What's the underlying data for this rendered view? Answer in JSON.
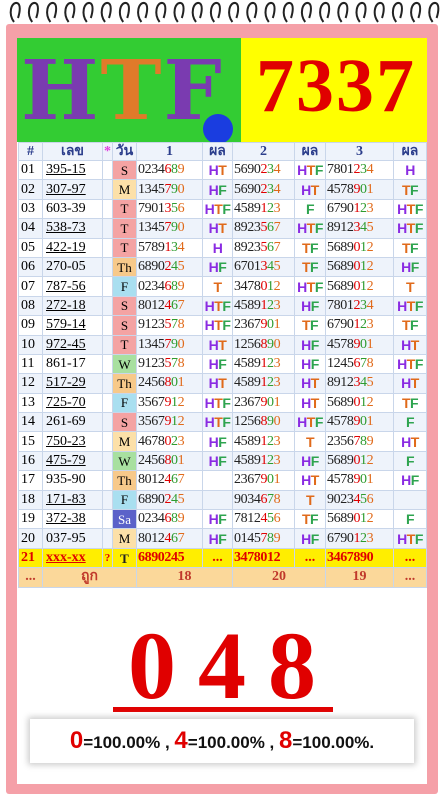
{
  "banner": {
    "brand": [
      "H",
      "T",
      "F",
      "."
    ],
    "number": "7337"
  },
  "table": {
    "headers": [
      "#",
      "เลข",
      "*",
      "วัน",
      "1",
      "ผล",
      "2",
      "ผล",
      "3",
      "ผล"
    ],
    "rows": [
      {
        "no": "01",
        "id": "395-15",
        "day": "S",
        "day_color": "#f4a3a3",
        "d1": "0234689",
        "r1": "HT",
        "d2": "5690234",
        "r2": "HTF",
        "d3": "7801234",
        "r3": "H",
        "u": true
      },
      {
        "no": "02",
        "id": "307-97",
        "day": "M",
        "day_color": "#fce0a8",
        "d1": "1345790",
        "r1": "HF",
        "d2": "5690234",
        "r2": "HT",
        "d3": "4578901",
        "r3": "TF",
        "u": true
      },
      {
        "no": "03",
        "id": "603-39",
        "day": "T",
        "day_color": "#f4a3a3",
        "d1": "7901356",
        "r1": "HTF",
        "d2": "4589123",
        "r2": "F",
        "d3": "6790123",
        "r3": "HTF",
        "u": false
      },
      {
        "no": "04",
        "id": "538-73",
        "day": "T",
        "day_color": "#f4a3a3",
        "d1": "1345790",
        "r1": "HT",
        "d2": "8923567",
        "r2": "HTF",
        "d3": "8912345",
        "r3": "HTF",
        "u": true
      },
      {
        "no": "05",
        "id": "422-19",
        "day": "T",
        "day_color": "#f4a3a3",
        "d1": "5789134",
        "r1": "H",
        "d2": "8923567",
        "r2": "TF",
        "d3": "5689012",
        "r3": "TF",
        "u": true
      },
      {
        "no": "06",
        "id": "270-05",
        "day": "Th",
        "day_color": "#f7c98a",
        "d1": "6890245",
        "r1": "HF",
        "d2": "6701345",
        "r2": "TF",
        "d3": "5689012",
        "r3": "HF",
        "u": false
      },
      {
        "no": "07",
        "id": "787-56",
        "day": "F",
        "day_color": "#a9dff0",
        "d1": "0234689",
        "r1": "T",
        "d2": "3478012",
        "r2": "HTF",
        "d3": "5689012",
        "r3": "T",
        "u": true
      },
      {
        "no": "08",
        "id": "272-18",
        "day": "S",
        "day_color": "#f4a3a3",
        "d1": "8012467",
        "r1": "HTF",
        "d2": "4589123",
        "r2": "HF",
        "d3": "7801234",
        "r3": "HTF",
        "u": true
      },
      {
        "no": "09",
        "id": "579-14",
        "day": "S",
        "day_color": "#f4a3a3",
        "d1": "9123578",
        "r1": "HTF",
        "d2": "2367901",
        "r2": "TF",
        "d3": "6790123",
        "r3": "TF",
        "u": true
      },
      {
        "no": "10",
        "id": "972-45",
        "day": "T",
        "day_color": "#f4a3a3",
        "d1": "1345790",
        "r1": "HT",
        "d2": "1256890",
        "r2": "HF",
        "d3": "4578901",
        "r3": "HT",
        "u": true
      },
      {
        "no": "11",
        "id": "861-17",
        "day": "W",
        "day_color": "#a8e0a0",
        "d1": "9123578",
        "r1": "HF",
        "d2": "4589123",
        "r2": "HF",
        "d3": "1245678",
        "r3": "HTF",
        "u": false
      },
      {
        "no": "12",
        "id": "517-29",
        "day": "Th",
        "day_color": "#f7c98a",
        "d1": "2456801",
        "r1": "HT",
        "d2": "4589123",
        "r2": "HT",
        "d3": "8912345",
        "r3": "HT",
        "u": true
      },
      {
        "no": "13",
        "id": "725-70",
        "day": "F",
        "day_color": "#a9dff0",
        "d1": "3567912",
        "r1": "HTF",
        "d2": "2367901",
        "r2": "HT",
        "d3": "5689012",
        "r3": "TF",
        "u": true
      },
      {
        "no": "14",
        "id": "261-69",
        "day": "S",
        "day_color": "#f4a3a3",
        "d1": "3567912",
        "r1": "HTF",
        "d2": "1256890",
        "r2": "HTF",
        "d3": "4578901",
        "r3": "F",
        "u": false
      },
      {
        "no": "15",
        "id": "750-23",
        "day": "M",
        "day_color": "#fce0a8",
        "d1": "4678023",
        "r1": "HF",
        "d2": "4589123",
        "r2": "T",
        "d3": "2356789",
        "r3": "HT",
        "u": true
      },
      {
        "no": "16",
        "id": "475-79",
        "day": "W",
        "day_color": "#a8e0a0",
        "d1": "2456801",
        "r1": "HF",
        "d2": "4589123",
        "r2": "HF",
        "d3": "5689012",
        "r3": "F",
        "u": true
      },
      {
        "no": "17",
        "id": "935-90",
        "day": "Th",
        "day_color": "#f7c98a",
        "d1": "8012467",
        "r1": "",
        "d2": "2367901",
        "r2": "HT",
        "d3": "4578901",
        "r3": "HF",
        "u": false
      },
      {
        "no": "18",
        "id": "171-83",
        "day": "F",
        "day_color": "#a9dff0",
        "d1": "6890245",
        "r1": "",
        "d2": "9034678",
        "r2": "T",
        "d3": "9023456",
        "r3": "",
        "u": true
      },
      {
        "no": "19",
        "id": "372-38",
        "day": "Sa",
        "day_color": "#5b62c9",
        "d1": "0234689",
        "r1": "HF",
        "d2": "7812456",
        "r2": "TF",
        "d3": "5689012",
        "r3": "F",
        "u": true
      },
      {
        "no": "20",
        "id": "037-95",
        "day": "M",
        "day_color": "#fce0a8",
        "d1": "8012467",
        "r1": "HF",
        "d2": "0145789",
        "r2": "HF",
        "d3": "6790123",
        "r3": "HTF",
        "u": false
      }
    ],
    "last_row": {
      "no": "21",
      "id": "xxx-xx",
      "star": "?",
      "day": "T",
      "d1": "6890245",
      "r1": "...",
      "d2": "3478012",
      "r2": "...",
      "d3": "3467890",
      "r3": "..."
    },
    "footer": {
      "c0": "...",
      "c1": "ถูก",
      "t1": "18",
      "t2": "20",
      "t3": "19",
      "c10": "..."
    }
  },
  "result": {
    "digits": [
      "0",
      "4",
      "8"
    ]
  },
  "percent": [
    {
      "digit": "0",
      "text": "=100.00%"
    },
    {
      "digit": "4",
      "text": "=100.00%"
    },
    {
      "digit": "8",
      "text": "=100.00%"
    }
  ]
}
